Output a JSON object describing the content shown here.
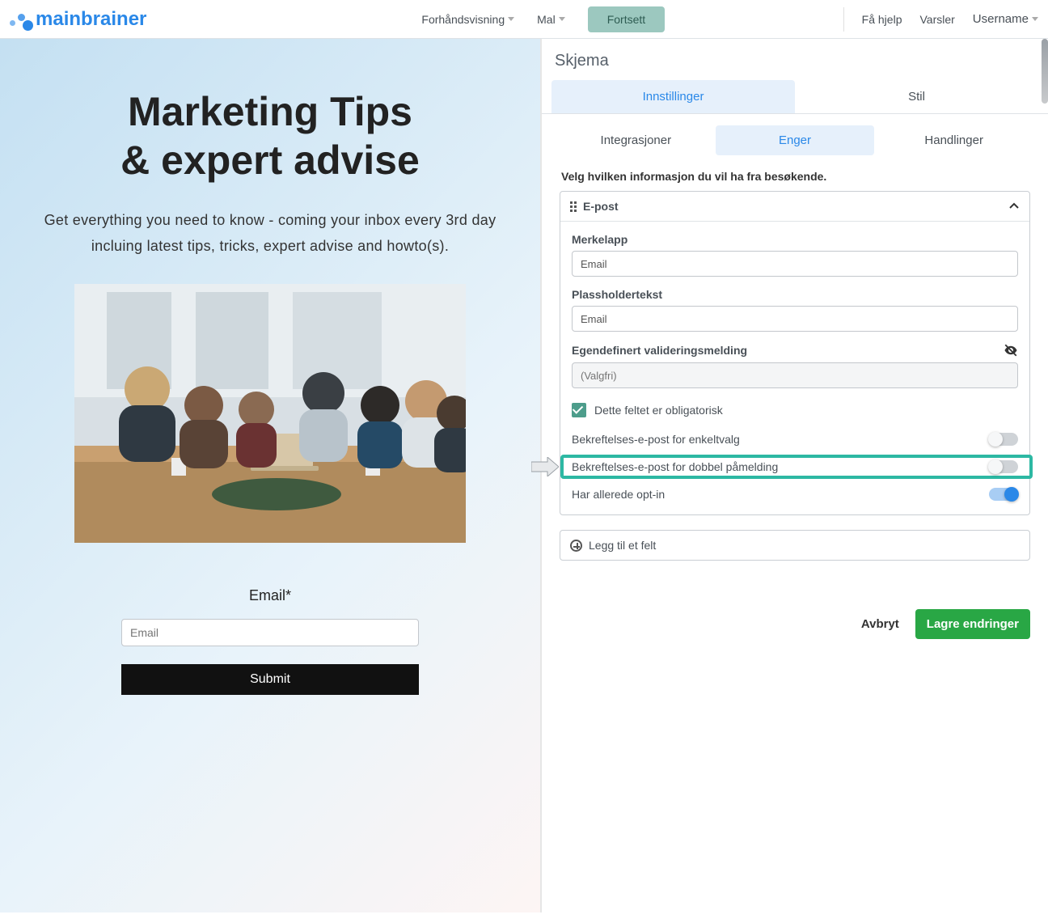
{
  "brand": "mainbrainer",
  "nav": {
    "preview": "Forhåndsvisning",
    "template": "Mal",
    "continue": "Fortsett",
    "help": "Få hjelp",
    "alerts": "Varsler",
    "username": "Username"
  },
  "preview": {
    "title_line1": "Marketing Tips",
    "title_line2": "& expert advise",
    "subtitle": "Get everything you need to know - coming your inbox every 3rd day incluing latest tips, tricks, expert advise and howto(s).",
    "form": {
      "label": "Email*",
      "placeholder": "Email",
      "submit": "Submit"
    }
  },
  "panel": {
    "title": "Skjema",
    "tabs": {
      "settings": "Innstillinger",
      "style": "Stil"
    },
    "subtabs": {
      "integrations": "Integrasjoner",
      "enger": "Enger",
      "actions": "Handlinger"
    },
    "section_desc": "Velg hvilken informasjon du vil ha fra besøkende.",
    "card": {
      "header": "E-post",
      "label_field": "Merkelapp",
      "label_value": "Email",
      "placeholder_field": "Plassholdertekst",
      "placeholder_value": "Email",
      "validation_field": "Egendefinert valideringsmelding",
      "validation_placeholder": "(Valgfri)",
      "required": "Dette feltet er obligatorisk",
      "single_optin": "Bekreftelses-e-post for enkeltvalg",
      "double_optin": "Bekreftelses-e-post for dobbel påmelding",
      "already_optin": "Har allerede opt-in"
    },
    "add_field": "Legg til et felt",
    "cancel": "Avbryt",
    "save": "Lagre endringer"
  }
}
